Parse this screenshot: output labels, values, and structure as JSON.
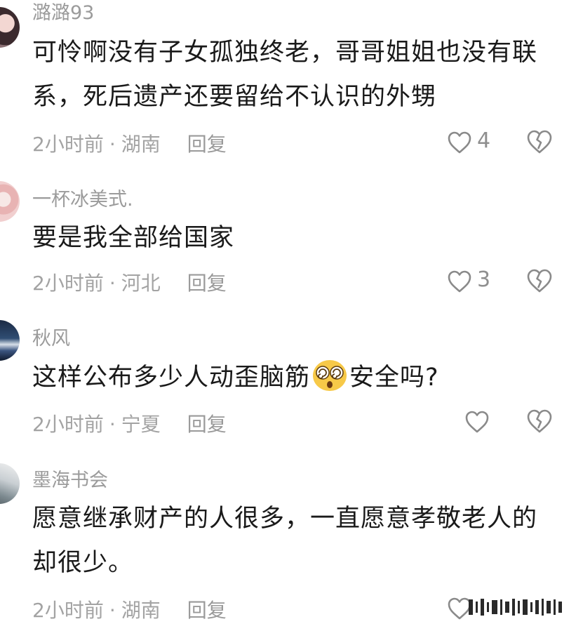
{
  "comments": [
    {
      "username": "潞潞93",
      "text": "可怜啊没有子女孤独终老，哥哥姐姐也没有联系，死后遗产还要留给不认识的外甥",
      "time": "2小时前",
      "location": "湖南",
      "reply_label": "回复",
      "likes": "4"
    },
    {
      "username": "一杯冰美式.",
      "text": "要是我全部给国家",
      "time": "2小时前",
      "location": "河北",
      "reply_label": "回复",
      "likes": "3"
    },
    {
      "username": "秋风",
      "text_before": "这样公布多少人动歪脑筋",
      "text_after": "安全吗?",
      "emoji": "dizzy-face-emoji",
      "time": "2小时前",
      "location": "宁夏",
      "reply_label": "回复",
      "likes": ""
    },
    {
      "username": "墨海书会",
      "text": "愿意继承财产的人很多，一直愿意孝敬老人的却很少。",
      "time": "2小时前",
      "location": "湖南",
      "reply_label": "回复",
      "likes": ""
    }
  ],
  "separator": "·",
  "icons": {
    "like": "heart-outline-icon",
    "dislike": "broken-heart-icon"
  },
  "colors": {
    "text": "#1a1a1a",
    "muted": "#9b9b9b",
    "icon": "#8a8a8a"
  }
}
